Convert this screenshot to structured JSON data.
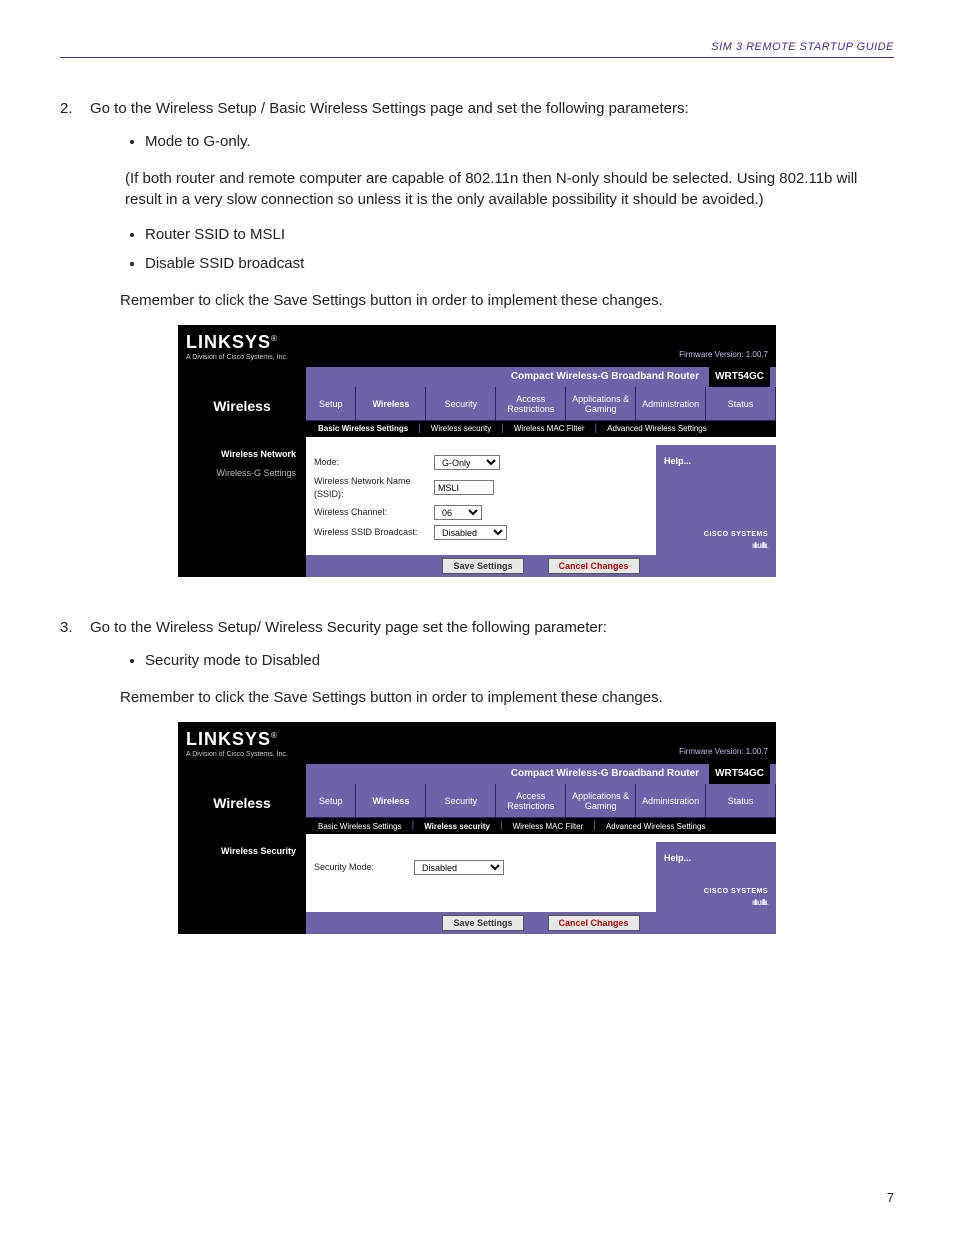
{
  "header": {
    "guide": "SIM 3 REMOTE STARTUP GUIDE"
  },
  "step2": {
    "num": "2.",
    "text": "Go to the Wireless Setup / Basic Wireless Settings page and set the following parameters:",
    "bullets": [
      "Mode to G-only."
    ],
    "note": "(If both router and remote computer are capable of 802.11n then N-only should be selected. Using 802.11b will result in a very slow connection so unless it is the only available possibility it should be avoided.)",
    "bullets2": [
      "Router SSID to MSLI",
      "Disable SSID broadcast"
    ],
    "remember": "Remember to click the Save Settings button in order to implement these changes."
  },
  "step3": {
    "num": "3.",
    "text": "Go to the Wireless Setup/ Wireless Security page set the following parameter:",
    "bullets": [
      "Security mode to Disabled"
    ],
    "remember": "Remember to click the Save Settings button in order to implement these changes."
  },
  "router": {
    "brand": "LINKSYS",
    "brandreg": "®",
    "tagline": "A Division of Cisco Systems, Inc.",
    "fw": "Firmware Version: 1.00.7",
    "product": "Compact Wireless-G Broadband Router",
    "model": "WRT54GC",
    "section": "Wireless",
    "tabs": [
      "Setup",
      "Wireless",
      "Security",
      "Access Restrictions",
      "Applications & Gaming",
      "Administration",
      "Status"
    ],
    "subtabs": [
      "Basic Wireless Settings",
      "Wireless security",
      "Wireless MAC Filter",
      "Advanced Wireless Settings"
    ],
    "help": "Help...",
    "save": "Save Settings",
    "cancel": "Cancel Changes",
    "cisco": "CISCO SYSTEMS"
  },
  "panel1": {
    "side": [
      "Wireless Network",
      "Wireless-G Settings"
    ],
    "rows": {
      "mode_l": "Mode:",
      "mode_v": "G-Only",
      "ssid_l": "Wireless Network Name (SSID):",
      "ssid_v": "MSLI",
      "chan_l": "Wireless Channel:",
      "chan_v": "06",
      "bcast_l": "Wireless SSID Broadcast:",
      "bcast_v": "Disabled"
    }
  },
  "panel2": {
    "side": [
      "Wireless Security"
    ],
    "rows": {
      "sec_l": "Security Mode:",
      "sec_v": "Disabled"
    }
  },
  "page": "7"
}
